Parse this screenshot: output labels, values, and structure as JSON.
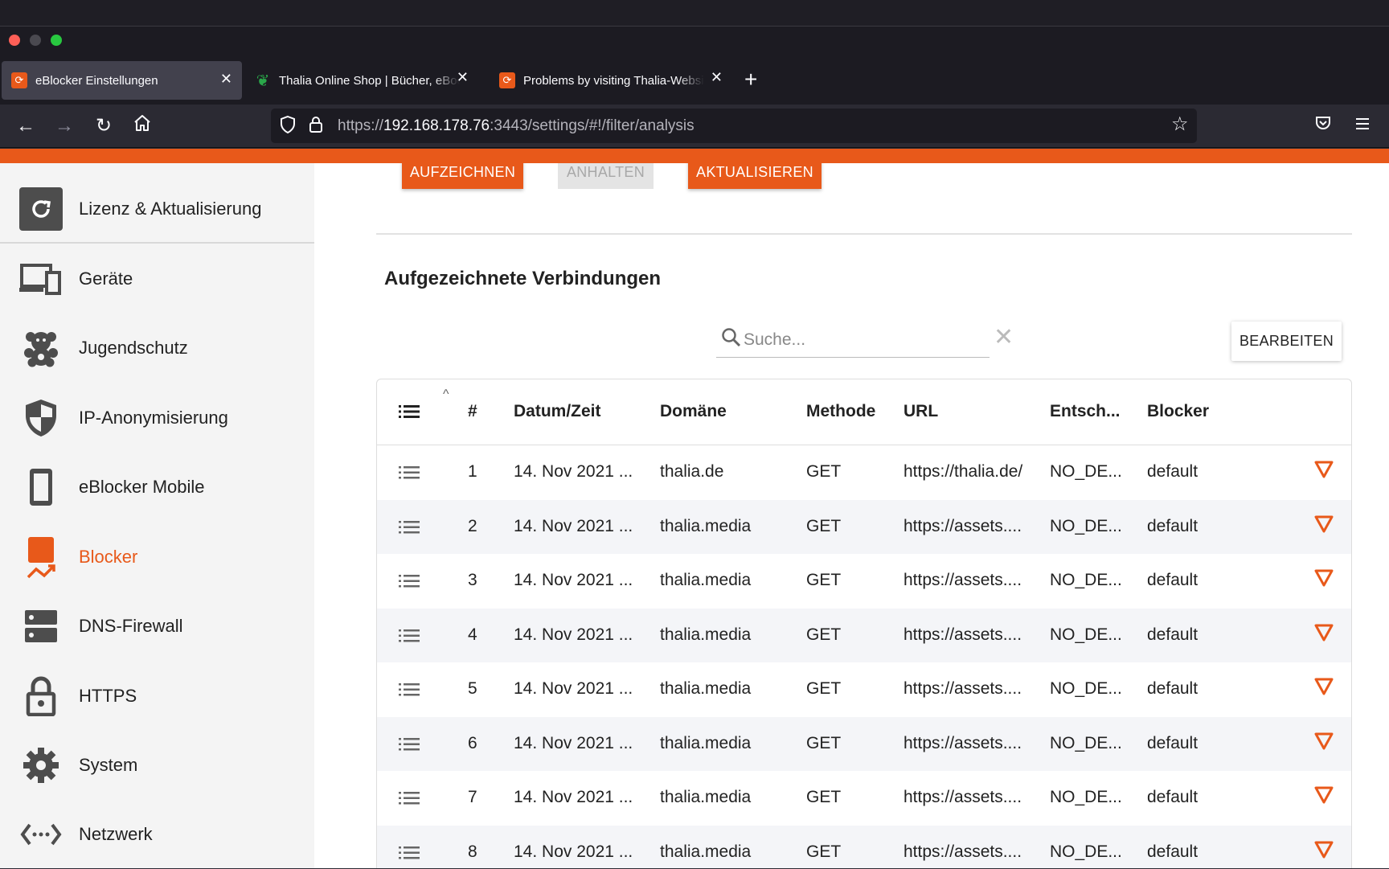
{
  "browser": {
    "tabs": [
      {
        "title": "eBlocker Einstellungen",
        "active": true
      },
      {
        "title": "Thalia Online Shop | Bücher, eBooks",
        "active": false
      },
      {
        "title": "Problems by visiting Thalia-Website",
        "active": false
      }
    ],
    "url_prefix": "https://",
    "url_host": "192.168.178.76",
    "url_rest": ":3443/settings/#!/filter/analysis"
  },
  "sidebar": {
    "items": [
      {
        "label": "Lizenz & Aktualisierung",
        "icon": "refresh-icon"
      },
      {
        "label": "Geräte",
        "icon": "devices-icon"
      },
      {
        "label": "Jugendschutz",
        "icon": "teddy-bear-icon"
      },
      {
        "label": "IP-Anonymisierung",
        "icon": "shield-icon"
      },
      {
        "label": "eBlocker Mobile",
        "icon": "mobile-icon"
      },
      {
        "label": "Blocker",
        "icon": "blocker-icon",
        "active": true
      },
      {
        "label": "DNS-Firewall",
        "icon": "server-icon"
      },
      {
        "label": "HTTPS",
        "icon": "lock-icon"
      },
      {
        "label": "System",
        "icon": "gear-icon"
      },
      {
        "label": "Netzwerk",
        "icon": "network-icon"
      }
    ]
  },
  "toolbar": {
    "record_label": "AUFZEICHNEN",
    "stop_label": "ANHALTEN",
    "refresh_label": "AKTUALISIEREN"
  },
  "main": {
    "section_title": "Aufgezeichnete Verbindungen",
    "search_placeholder": "Suche...",
    "edit_label": "BEARBEITEN"
  },
  "table": {
    "headers": {
      "num": "#",
      "datetime": "Datum/Zeit",
      "domain": "Domäne",
      "method": "Methode",
      "url": "URL",
      "decision": "Entsch...",
      "blocker": "Blocker"
    },
    "rows": [
      {
        "num": "1",
        "datetime": "14. Nov 2021 ...",
        "domain": "thalia.de",
        "method": "GET",
        "url": "https://thalia.de/",
        "decision": "NO_DE...",
        "blocker": "default"
      },
      {
        "num": "2",
        "datetime": "14. Nov 2021 ...",
        "domain": "thalia.media",
        "method": "GET",
        "url": "https://assets....",
        "decision": "NO_DE...",
        "blocker": "default"
      },
      {
        "num": "3",
        "datetime": "14. Nov 2021 ...",
        "domain": "thalia.media",
        "method": "GET",
        "url": "https://assets....",
        "decision": "NO_DE...",
        "blocker": "default"
      },
      {
        "num": "4",
        "datetime": "14. Nov 2021 ...",
        "domain": "thalia.media",
        "method": "GET",
        "url": "https://assets....",
        "decision": "NO_DE...",
        "blocker": "default"
      },
      {
        "num": "5",
        "datetime": "14. Nov 2021 ...",
        "domain": "thalia.media",
        "method": "GET",
        "url": "https://assets....",
        "decision": "NO_DE...",
        "blocker": "default"
      },
      {
        "num": "6",
        "datetime": "14. Nov 2021 ...",
        "domain": "thalia.media",
        "method": "GET",
        "url": "https://assets....",
        "decision": "NO_DE...",
        "blocker": "default"
      },
      {
        "num": "7",
        "datetime": "14. Nov 2021 ...",
        "domain": "thalia.media",
        "method": "GET",
        "url": "https://assets....",
        "decision": "NO_DE...",
        "blocker": "default"
      },
      {
        "num": "8",
        "datetime": "14. Nov 2021 ...",
        "domain": "thalia.media",
        "method": "GET",
        "url": "https://assets....",
        "decision": "NO_DE...",
        "blocker": "default"
      }
    ]
  },
  "colors": {
    "accent": "#e8591a",
    "sidebar_bg": "#f4f4f4",
    "row_alt": "#f4f5f8"
  }
}
